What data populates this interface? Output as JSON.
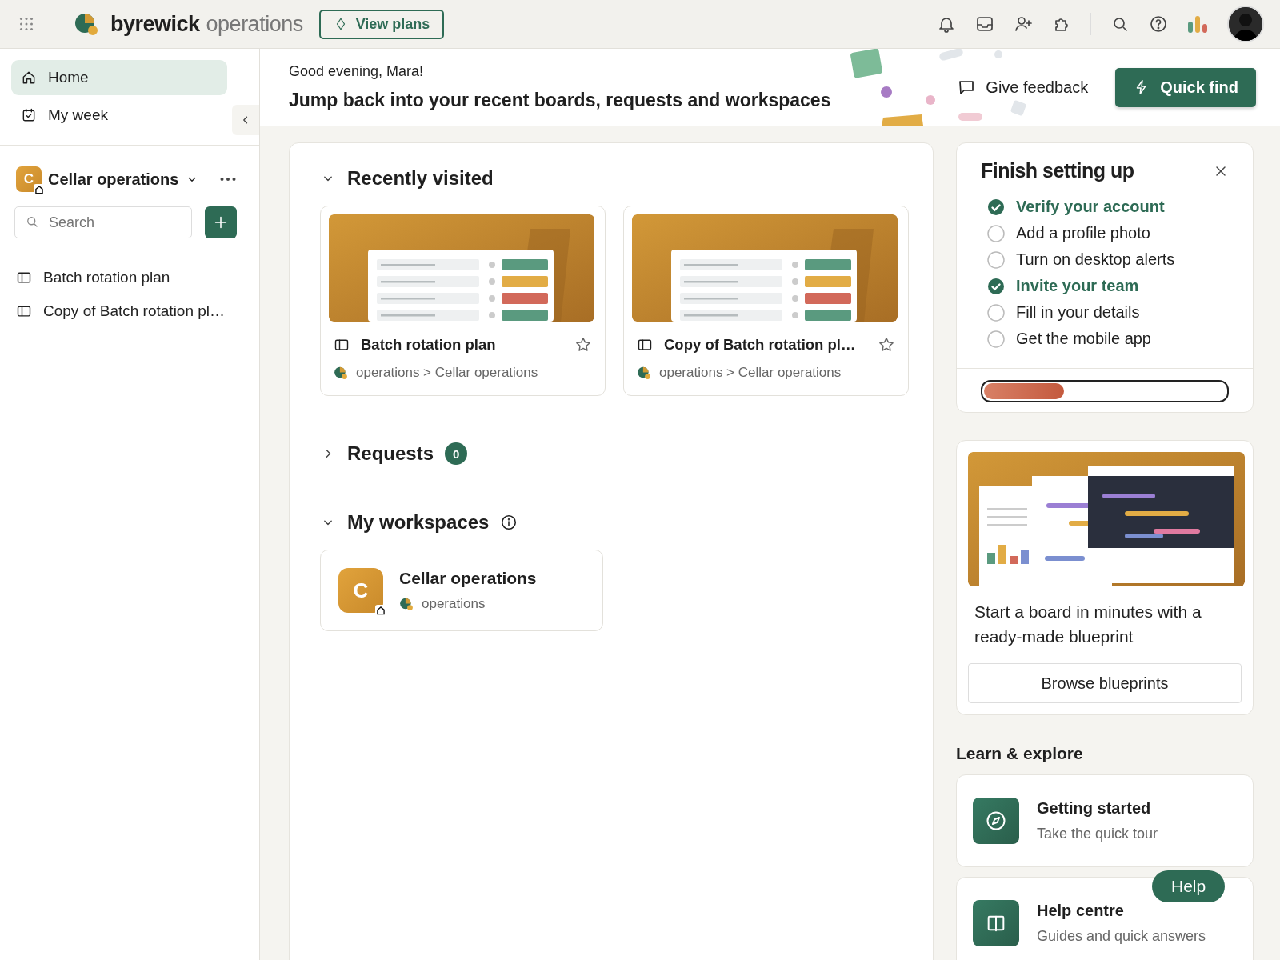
{
  "app_bar": {
    "brand": "byrewick",
    "product": "operations",
    "plans_button": "View plans"
  },
  "sidebar": {
    "nav": [
      {
        "kind": "home",
        "label": "Home",
        "selected": true
      },
      {
        "kind": "week",
        "label": "My week",
        "selected": false
      }
    ],
    "workspace": {
      "initial": "C",
      "name": "Cellar operations"
    },
    "search": {
      "placeholder": "Search"
    },
    "boards": [
      "Batch rotation plan",
      "Copy of Batch rotation pl…"
    ]
  },
  "header": {
    "greeting": "Good evening, Mara!",
    "headline": "Jump back into your recent boards, requests and workspaces",
    "feedback": "Give feedback",
    "quick_find": "Quick find"
  },
  "recent": {
    "title": "Recently visited",
    "expanded": true,
    "boards": [
      {
        "name": "Batch rotation plan",
        "path": "operations > Cellar operations",
        "starred": false
      },
      {
        "name": "Copy of Batch rotation pl…",
        "path": "operations > Cellar operations",
        "starred": false
      }
    ]
  },
  "requests": {
    "title": "Requests",
    "count": "0",
    "expanded": false
  },
  "workspaces": {
    "title": "My workspaces",
    "expanded": true,
    "items": [
      {
        "initial": "C",
        "name": "Cellar operations",
        "account": "operations"
      }
    ]
  },
  "setup": {
    "title": "Finish setting up",
    "level": 0.33,
    "tasks": [
      {
        "label": "Verify your account",
        "checked": true
      },
      {
        "label": "Add a profile photo",
        "checked": false
      },
      {
        "label": "Turn on desktop alerts",
        "checked": false
      },
      {
        "label": "Invite your team",
        "checked": true
      },
      {
        "label": "Fill in your details",
        "checked": false
      },
      {
        "label": "Get the mobile app",
        "checked": false
      }
    ]
  },
  "blueprint": {
    "text": "Start a board in minutes with a ready-made blueprint",
    "button": "Browse blueprints"
  },
  "learn": {
    "title": "Learn & explore",
    "items": [
      {
        "kind": "tour",
        "title": "Getting started",
        "subtitle": "Take the quick tour"
      },
      {
        "kind": "help",
        "title": "Help centre",
        "subtitle": "Guides and quick answers"
      }
    ]
  },
  "help_button": "Help"
}
